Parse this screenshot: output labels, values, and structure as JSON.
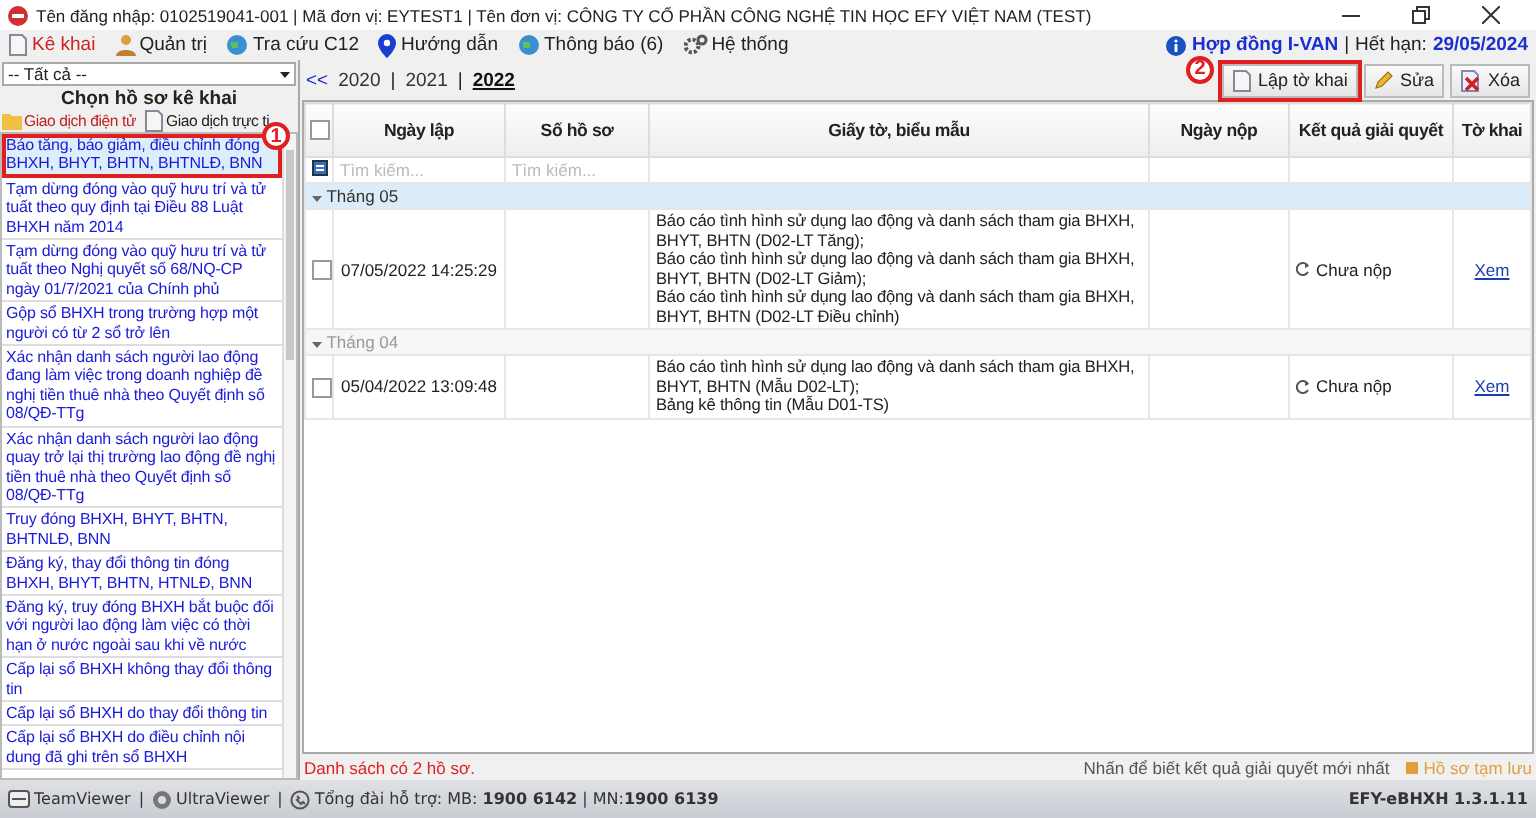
{
  "title_bar": {
    "title": "Tên đăng nhập: 0102519041-001 | Mã đơn vị: EYTEST1 | Tên đơn vị: CÔNG TY CỔ PHẦN CÔNG NGHỆ TIN HỌC EFY VIỆT NAM (TEST)"
  },
  "menu": [
    {
      "label": "Kê khai",
      "selected": true
    },
    {
      "label": "Quản trị",
      "selected": false
    },
    {
      "label": "Tra cứu C12",
      "selected": false
    },
    {
      "label": "Hướng dẫn",
      "selected": false
    },
    {
      "label": "Thông báo (6)",
      "selected": false
    },
    {
      "label": "Hệ thống",
      "selected": false
    }
  ],
  "contract": {
    "link": "Hợp đồng I-VAN",
    "separator": "|",
    "expiry_label": "Hết hạn:",
    "expiry": "29/05/2024"
  },
  "sidebar": {
    "filter": "-- Tất cả --",
    "heading": "Chọn hồ sơ kê khai",
    "callout": "1",
    "tabs": [
      {
        "label": "Giao dịch điện tử",
        "selected": true
      },
      {
        "label": "Giao dịch trực ti",
        "selected": false
      }
    ],
    "items": [
      {
        "label": "Báo tăng, báo giảm, điều chỉnh đóng BHXH, BHYT, BHTN, BHTNLĐ, BNN",
        "selected": true
      },
      {
        "label": "Tạm dừng đóng vào quỹ hưu trí và tử tuất theo quy định tại Điều  88 Luật BHXH năm 2014",
        "selected": false
      },
      {
        "label": "Tạm dừng đóng vào quỹ hưu trí và tử tuất theo Nghị quyết số 68/NQ-CP ngày 01/7/2021 của Chính phủ",
        "selected": false
      },
      {
        "label": "Gộp sổ BHXH trong trường hợp một người có từ 2 sổ trở lên",
        "selected": false
      },
      {
        "label": "Xác nhận danh sách người lao động đang làm việc trong doanh nghiệp đề nghị tiền thuê nhà theo Quyết định số 08/QĐ-TTg",
        "selected": false
      },
      {
        "label": "Xác nhận danh sách người lao động quay trở lại thị trường lao động đề nghị tiền thuê nhà theo Quyết định số 08/QĐ-TTg",
        "selected": false
      },
      {
        "label": "Truy đóng  BHXH,  BHYT, BHTN, BHTNLĐ, BNN",
        "selected": false
      },
      {
        "label": "Đăng ký, thay đổi thông tin đóng BHXH, BHYT, BHTN, HTNLĐ, BNN",
        "selected": false
      },
      {
        "label": "Đăng  ký, truy đóng  BHXH bắt buộc đối với người  lao động làm việc có thời hạn ở nước ngoài sau khi về nước",
        "selected": false
      },
      {
        "label": "Cấp lại sổ BHXH không thay đổi thông tin",
        "selected": false
      },
      {
        "label": "Cấp lại sổ BHXH do thay đổi thông tin",
        "selected": false
      },
      {
        "label": "Cấp lại sổ BHXH do điều chỉnh nội dung đã ghi trên sổ BHXH",
        "selected": false
      }
    ]
  },
  "years": {
    "back": "<<",
    "separators": [
      "|",
      "|"
    ],
    "items": [
      {
        "label": "2020",
        "selected": false
      },
      {
        "label": "2021",
        "selected": false
      },
      {
        "label": "2022",
        "selected": true
      }
    ]
  },
  "toolbar": {
    "callout": "2",
    "buttons": [
      "Lập tờ khai",
      "Sửa",
      "Xóa"
    ]
  },
  "table": {
    "select_all_checked": false,
    "columns": [
      "Ngày lập",
      "Số hồ sơ",
      "Giấy tờ, biểu mẫu",
      "Ngày nộp",
      "Kết quả giải quyết",
      "Tờ khai"
    ],
    "search_placeholders": [
      "Tìm kiếm...",
      "Tìm kiếm..."
    ],
    "groups": [
      {
        "label": "Tháng 05",
        "selected": true,
        "rows": [
          {
            "checked": false,
            "date": "07/05/2022 14:25:29",
            "forms": [
              "Báo cáo tình hình sử dụng lao động và danh sách tham gia BHXH, BHYT, BHTN (D02-LT Tăng);",
              "Báo cáo tình hình sử dụng lao động và danh sách tham gia BHXH, BHYT, BHTN (D02-LT Giảm);",
              "Báo cáo tình hình sử dụng lao động và danh sách tham gia BHXH, BHYT, BHTN (D02-LT Điều chỉnh)"
            ],
            "status": "Chưa nộp",
            "link": "Xem"
          }
        ]
      },
      {
        "label": "Tháng 04",
        "selected": false,
        "rows": [
          {
            "checked": false,
            "date": "05/04/2022 13:09:48",
            "forms": [
              "Báo cáo tình hình sử dụng lao động và danh sách tham gia BHXH, BHYT, BHTN (Mẫu D02-LT);",
              "Bảng kê thông tin (Mẫu D01-TS)"
            ],
            "status": "Chưa nộp",
            "link": "Xem"
          }
        ]
      }
    ]
  },
  "footer": {
    "count": "Danh sách có 2 hồ sơ.",
    "hint": "Nhấn để biết kết quả giải quyết mới nhất",
    "legend": {
      "label": "Hồ sơ tạm lưu",
      "color": "#e0a040"
    }
  },
  "status_bar": {
    "apps": [
      "TeamViewer",
      "UltraViewer"
    ],
    "separators": [
      "|",
      "|"
    ],
    "support": "Tổng đài hỗ trợ: MB: **1900 6142** | MN:**1900 6139**",
    "version": "EFY-eBHXH 1.3.1.11"
  }
}
